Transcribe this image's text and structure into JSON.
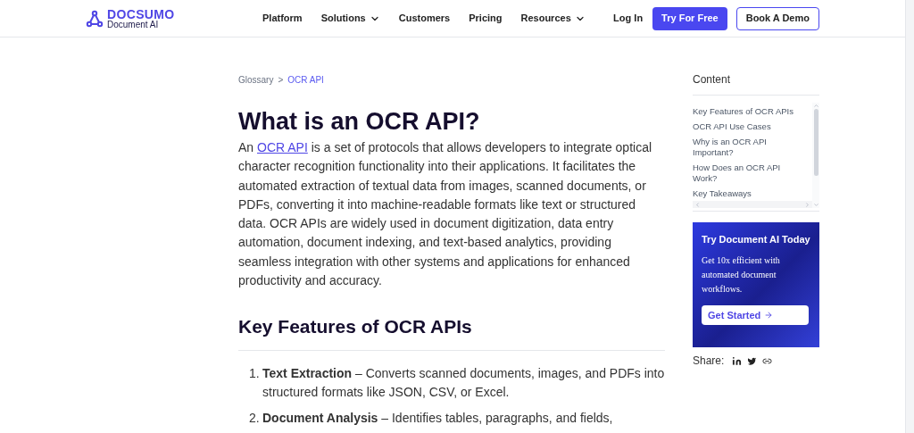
{
  "header": {
    "logo": {
      "name": "DOCSUMO",
      "tagline": "Document AI"
    },
    "nav": [
      {
        "label": "Platform",
        "dropdown": false
      },
      {
        "label": "Solutions",
        "dropdown": true
      },
      {
        "label": "Customers",
        "dropdown": false
      },
      {
        "label": "Pricing",
        "dropdown": false
      },
      {
        "label": "Resources",
        "dropdown": true
      }
    ],
    "login": "Log In",
    "primary_button": "Try For Free",
    "secondary_button": "Book A Demo"
  },
  "breadcrumb": [
    {
      "label": "Glossary",
      "current": false
    },
    {
      "label": "OCR API",
      "current": true
    }
  ],
  "breadcrumb_separator": ">",
  "title": "What is an OCR API?",
  "intro": {
    "before": "An ",
    "link": "OCR API",
    "after": " is a set of protocols that allows developers to integrate optical character recognition functionality into their applications. It facilitates the automated extraction of textual data from images, scanned documents, or PDFs, converting it into machine-readable formats like text or structured data. OCR APIs are widely used in document digitization, data entry automation, document indexing, and text-based analytics, providing seamless integration with other systems and applications for enhanced productivity and accuracy."
  },
  "section_heading": "Key Features of OCR APIs",
  "features": [
    {
      "number": "1.",
      "text": "**Text Extraction** – Converts scanned documents, images, and PDFs into structured formats like JSON, CSV, or Excel."
    },
    {
      "number": "2.",
      "text": "**Document Analysis** – Identifies tables, paragraphs, and fields,"
    }
  ],
  "sidebar": {
    "heading": "Content",
    "toc": [
      "Key Features of OCR APIs",
      "OCR API Use Cases",
      "Why is an OCR API Important?",
      "How Does an OCR API Work?",
      "Key Takeaways"
    ],
    "promo": {
      "title": "Try Document AI Today",
      "text": "Get 10x efficient with automated document workflows.",
      "button": "Get Started"
    },
    "share_label": "Share:"
  }
}
